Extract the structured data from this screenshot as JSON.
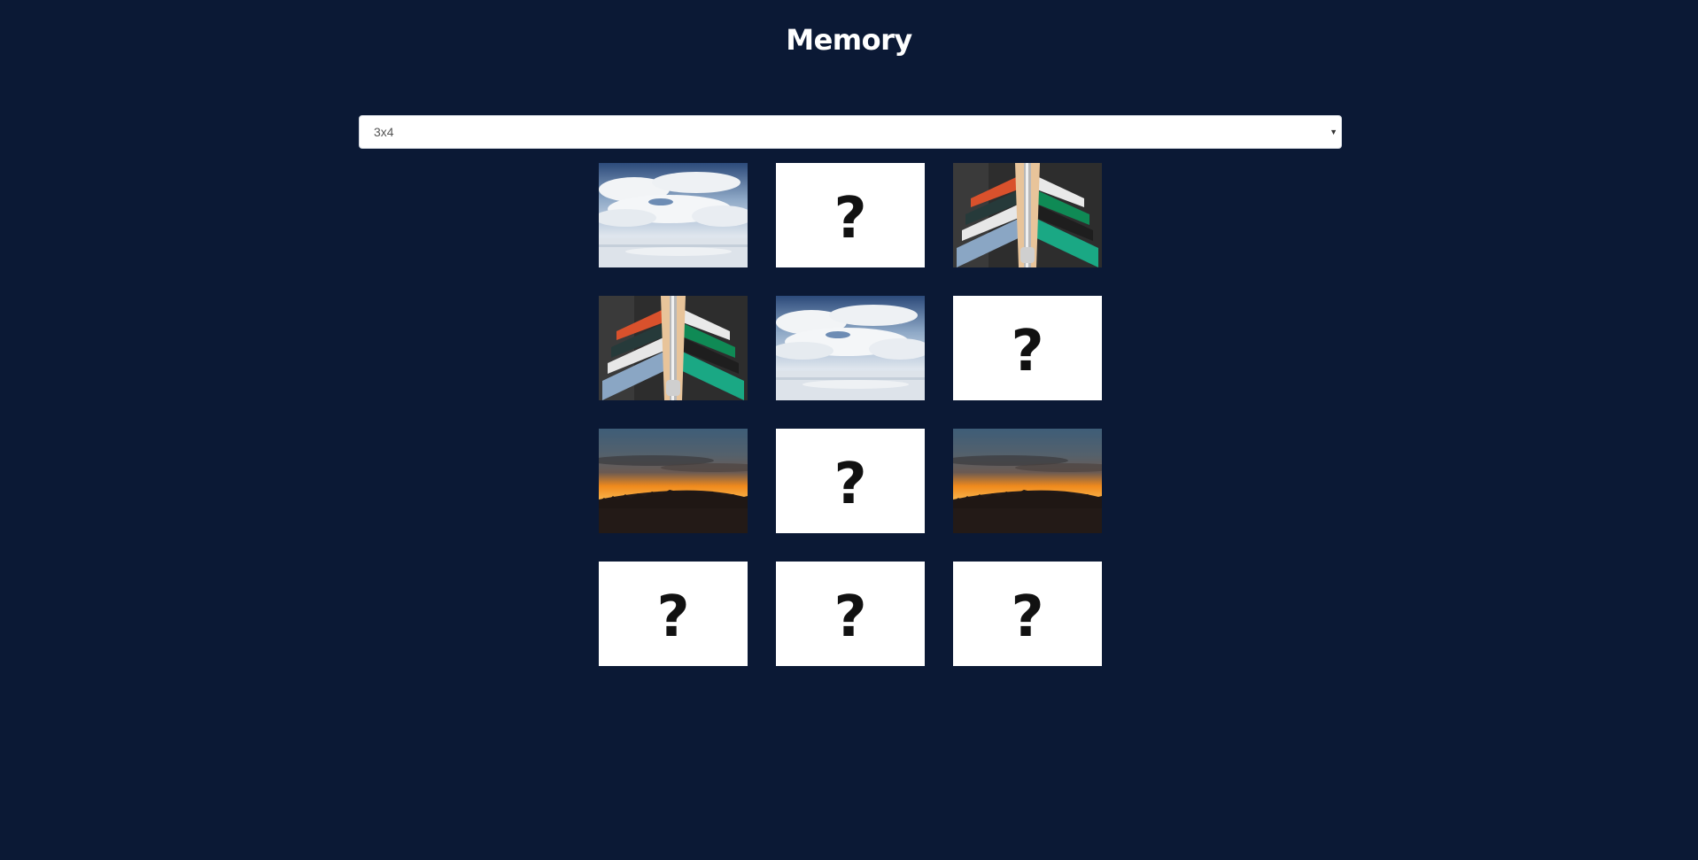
{
  "title": "Memory",
  "size_select": {
    "value": "3x4"
  },
  "cards": [
    {
      "state": "revealed",
      "image": "sky-clouds"
    },
    {
      "state": "hidden",
      "label": "?"
    },
    {
      "state": "revealed",
      "image": "clothes-rack"
    },
    {
      "state": "revealed",
      "image": "clothes-rack"
    },
    {
      "state": "revealed",
      "image": "sky-clouds"
    },
    {
      "state": "hidden",
      "label": "?"
    },
    {
      "state": "revealed",
      "image": "sunset-hill"
    },
    {
      "state": "hidden",
      "label": "?"
    },
    {
      "state": "revealed",
      "image": "sunset-hill"
    },
    {
      "state": "hidden",
      "label": "?"
    },
    {
      "state": "hidden",
      "label": "?"
    },
    {
      "state": "hidden",
      "label": "?"
    }
  ],
  "colors": {
    "background": "#0b1935",
    "card_back": "#ffffff",
    "title": "#ffffff"
  }
}
